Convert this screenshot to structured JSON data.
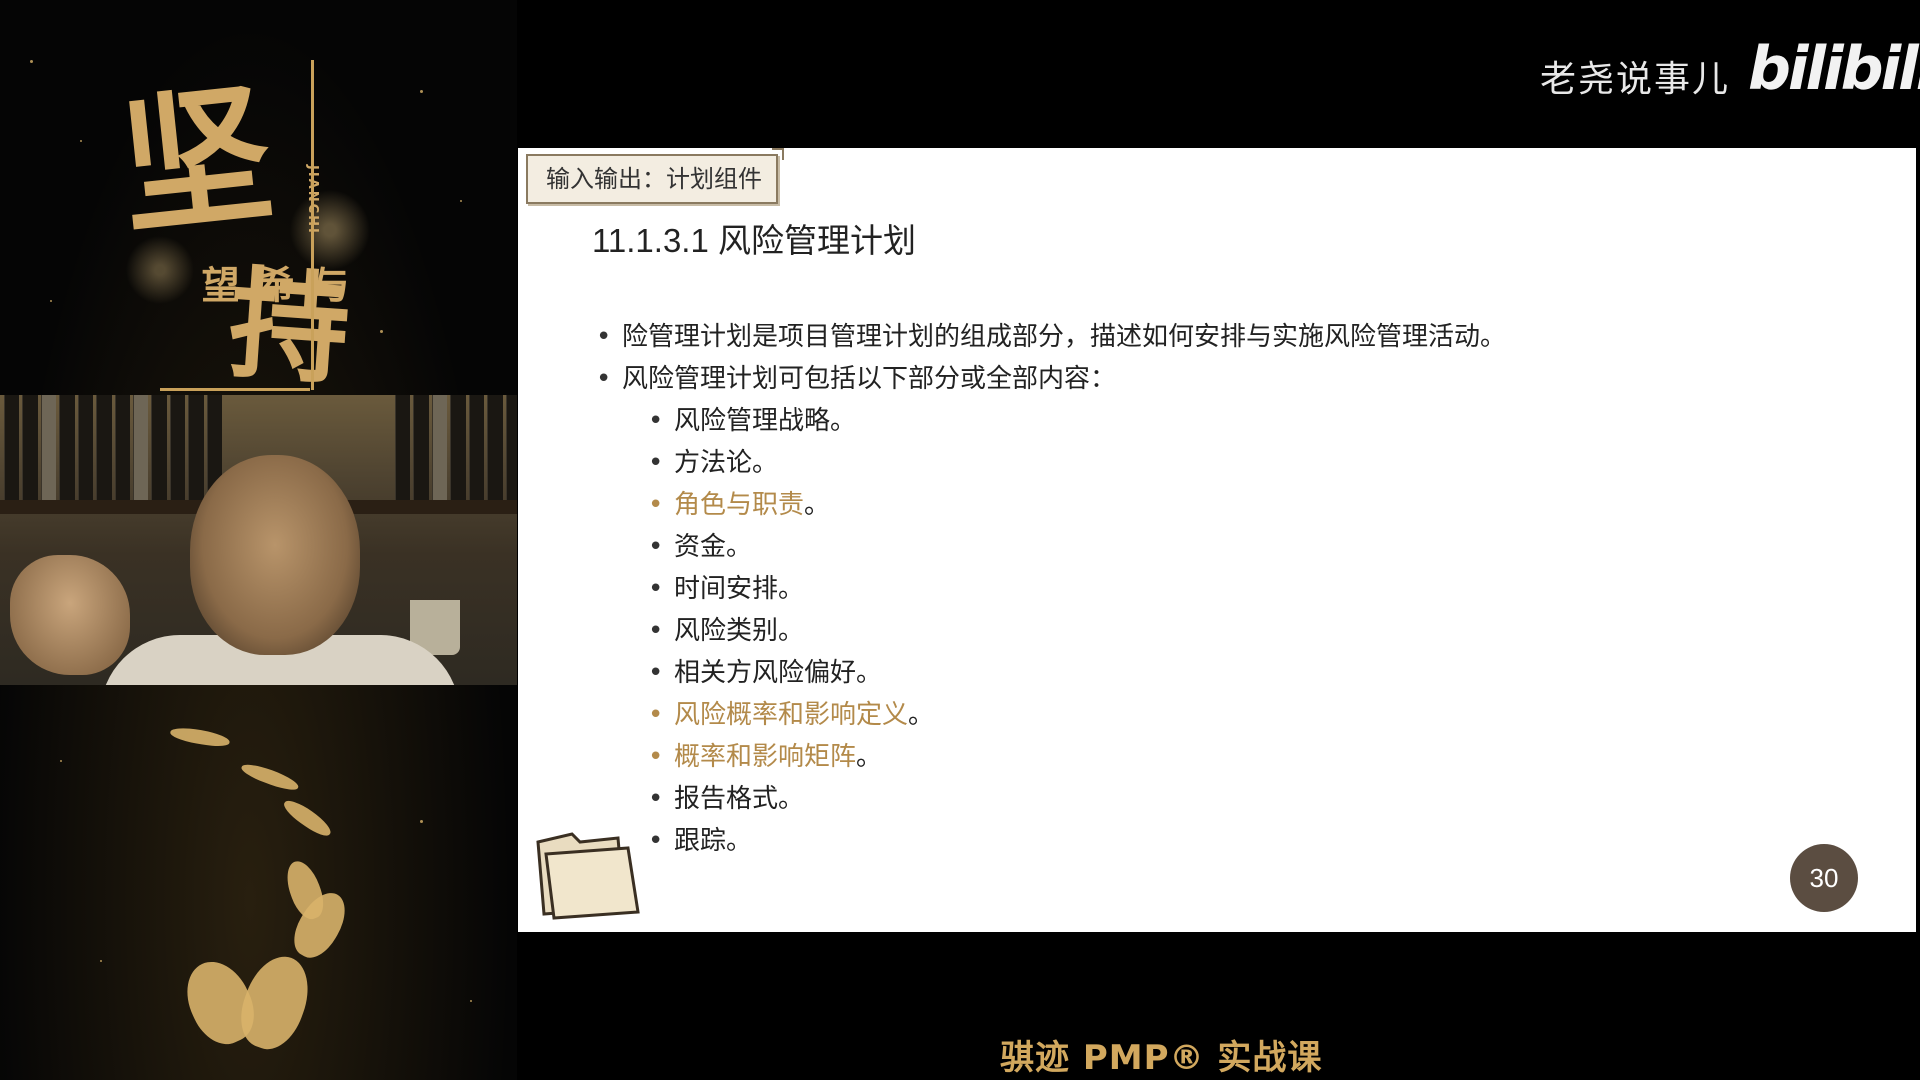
{
  "poster": {
    "title_big": "坚",
    "title_big2": "持",
    "subtitle": "与希望",
    "pinyin": "JIANCHI"
  },
  "brand": {
    "channel_name": "老尧说事儿",
    "logo": "bilibili"
  },
  "slide": {
    "tag": "输入输出：计划组件",
    "title": "11.1.3.1 风险管理计划",
    "bullets": [
      "险管理计划是项目管理计划的组成部分，描述如何安排与实施风险管理活动。",
      "风险管理计划可包括以下部分或全部内容："
    ],
    "sub_items": [
      {
        "text": "风险管理战略",
        "punct": "。"
      },
      {
        "text": "方法论",
        "punct": "。"
      },
      {
        "text": "角色与职责",
        "punct": "。"
      },
      {
        "text": "资金",
        "punct": "。"
      },
      {
        "text": "时间安排",
        "punct": "。"
      },
      {
        "text": "风险类别",
        "punct": "。"
      },
      {
        "text": "相关方风险偏好",
        "punct": "。"
      },
      {
        "text": "风险概率和影响定义",
        "punct": "。"
      },
      {
        "text": "概率和影响矩阵",
        "punct": "。"
      },
      {
        "text": "报告格式",
        "punct": "。"
      },
      {
        "text": "跟踪",
        "punct": "。"
      }
    ],
    "page_number": "30",
    "highlight_color": "#b38a4a"
  },
  "footer": {
    "course_title": "骐迹 PMP® 实战课"
  }
}
